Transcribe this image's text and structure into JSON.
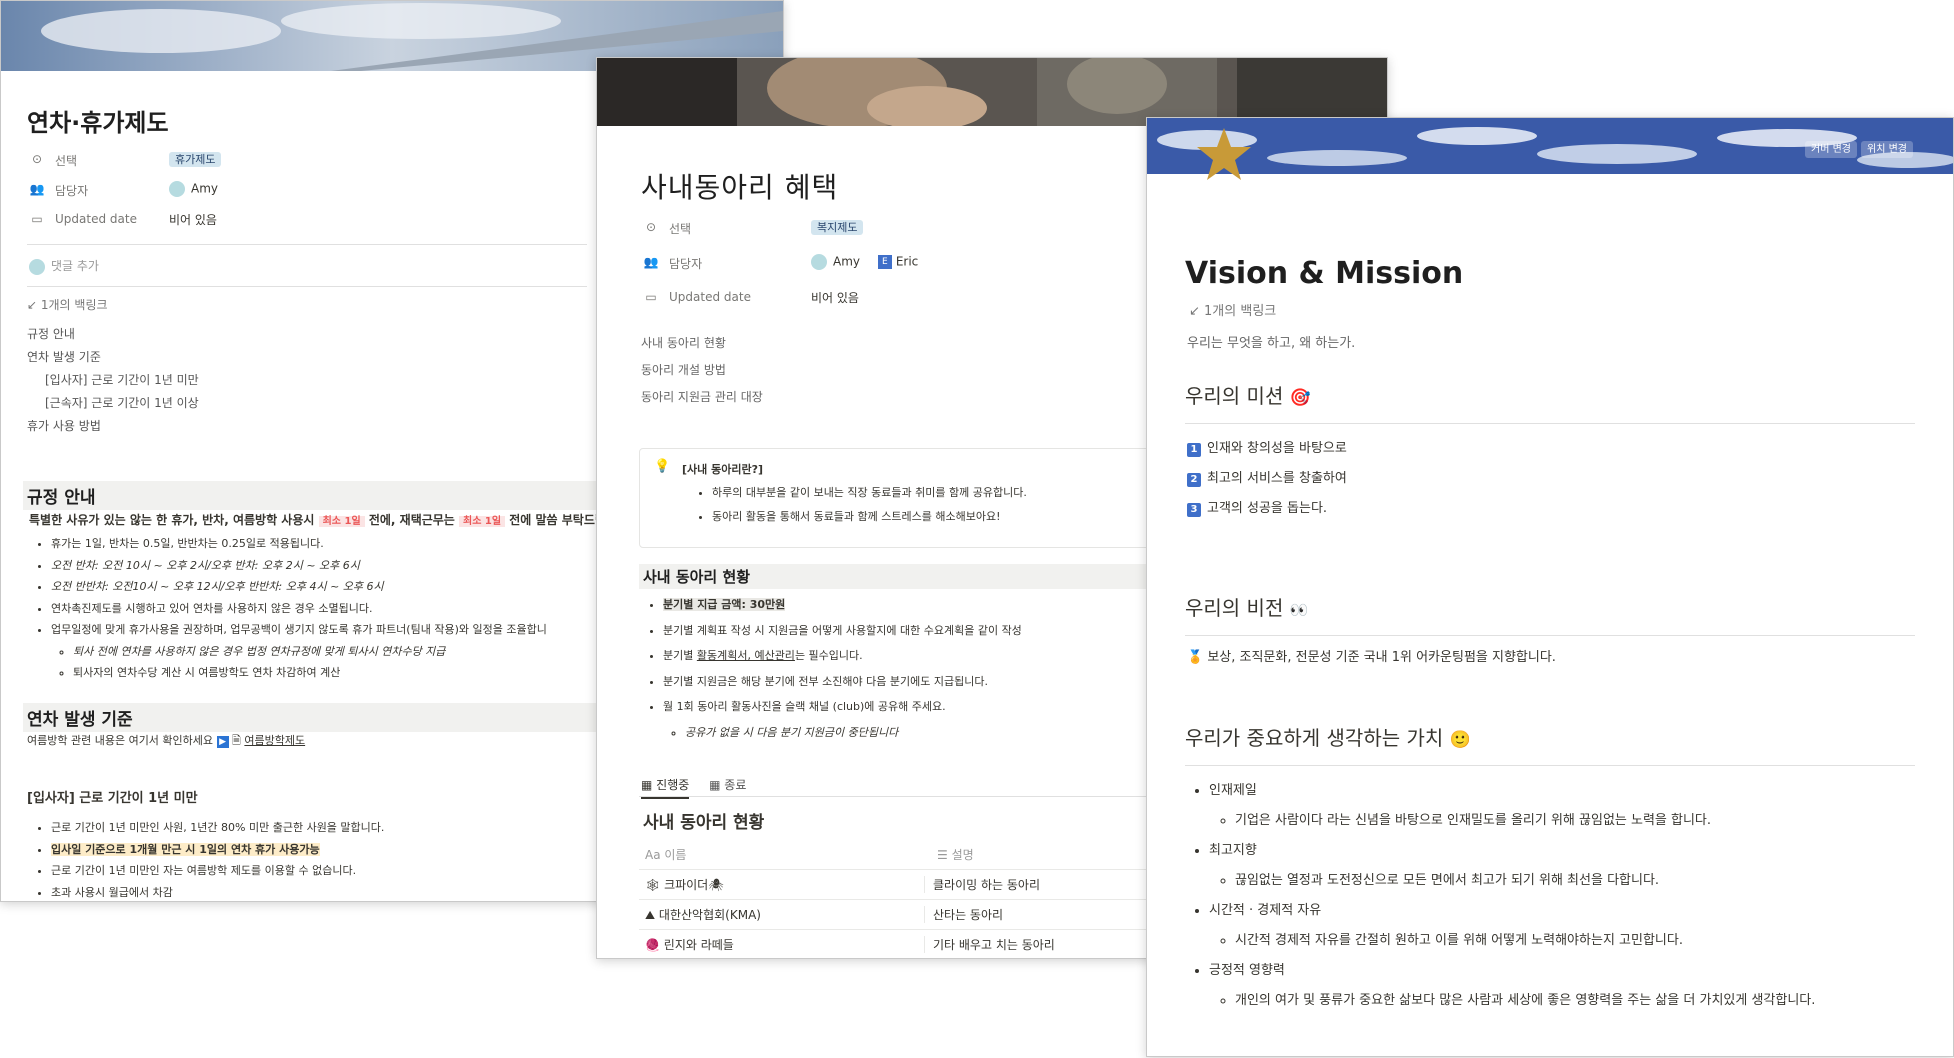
{
  "page1": {
    "title": "연차·휴가제도",
    "props": [
      {
        "icon": "⊙",
        "name": "선택",
        "value": "휴가제도"
      },
      {
        "icon": "👥",
        "name": "담당자",
        "value": "Amy"
      },
      {
        "icon": "▭",
        "name": "Updated date",
        "value": "비어 있음"
      }
    ],
    "comment": "댓글 추가",
    "backlinks": "1개의 백링크",
    "toc": [
      "규정 안내",
      "연차 발생 기준",
      "[입사자] 근로 기간이 1년 미만",
      "[근속자] 근로 기간이 1년 이상",
      "휴가 사용 방법"
    ],
    "sec1": {
      "heading": "규정 안내",
      "lead": {
        "a": "특별한 사유가 있는 않는 한 휴가, 반차, 여름방학 사용시 ",
        "tag1": "최소 1일",
        "b": " 전에, 재택근무는 ",
        "tag2": "최소 1일",
        "c": " 전에 말씀 부탁드립"
      },
      "bullets": [
        "휴가는 1일, 반차는 0.5일, 반반차는 0.25일로 적용됩니다.",
        "오전 반차: 오전 10시 ~ 오후 2시/오후 반차: 오후 2시 ~ 오후 6시",
        "오전 반반차: 오전10시 ~ 오후 12시/오후 반반차: 오후 4시 ~ 오후 6시",
        "연차촉진제도를 시행하고 있어 연차를 사용하지 않은 경우 소멸됩니다.",
        "업무일정에 맞게 휴가사용을 권장하며, 업무공백이 생기지 않도록 휴가 파트너(팀내 작용)와 일정을 조율합니"
      ],
      "subbullets": [
        "퇴사 전에 연차를 사용하지 않은 경우 법정 연차규정에 맞게 퇴사시 연차수당 지급",
        "퇴사자의 연차수당 계산 시 여름방학도 연차 차감하여 계산"
      ]
    },
    "sec2": {
      "heading": "연차 발생 기준",
      "line_prefix": "여름방학 관련 내용은 여기서 확인하세요 ",
      "link": "여름방학제도",
      "subheading": "[입사자] 근로 기간이 1년 미만",
      "bullets": [
        "근로 기간이 1년 미만인 사원, 1년간 80% 미만 출근한 사원을 말합니다.",
        "입사일 기준으로 1개월 만근 시 1일의 연차 휴가 사용가능",
        "근로 기간이 1년 미만인 자는 여름방학 제도를 이용할 수 없습니다.",
        "초과 사용시 월급에서 차감"
      ]
    }
  },
  "page2": {
    "title": "사내동아리 혜택",
    "props": [
      {
        "icon": "⊙",
        "name": "선택",
        "value": "복지제도"
      },
      {
        "icon": "👥",
        "name": "담당자",
        "value": "Amy",
        "value2": "Eric",
        "value2_initial": "E"
      },
      {
        "icon": "▭",
        "name": "Updated date",
        "value": "비어 있음"
      }
    ],
    "toc": [
      "사내 동아리 현황",
      "동아리 개설 방법",
      "동아리 지원금 관리 대장"
    ],
    "callout": {
      "icon": "💡",
      "title": "[사내 동아리란?]",
      "bullets": [
        "하루의 대부분을 같이 보내는 직장 동료들과 취미를 함께 공유합니다.",
        "동아리 활동을 통해서 동료들과 함께 스트레스를 해소해보아요!"
      ]
    },
    "sec1": {
      "heading": "사내 동아리 현황",
      "bullets": [
        "분기별 지급 금액: 30만원",
        "분기별 계획표 작성 시 지원금을 어떻게 사용할지에 대한 수요계획을 같이 작성",
        "분기별 활동계획서, 예산관리는 필수입니다.",
        "분기별 지원금은 해당 분기에 전부 소진해야 다음 분기에도 지급됩니다.",
        "월 1회 동아리 활동사진을 슬랙 채널 (club)에 공유해 주세요."
      ],
      "bullet4_highlight": "활동계획서, 예산관리",
      "bullet4_rest": "는 필수입니다.",
      "bullet4_pre": "분기별 ",
      "subbullet": "공유가 없을 시 다음 분기 지원금이 중단됩니다"
    },
    "tabs": [
      "진행중",
      "종료"
    ],
    "db": {
      "title": "사내 동아리 현황",
      "col_name": "이름",
      "col_desc": "설명",
      "rows": [
        {
          "icon": "🕸",
          "name": "크파이더🕷",
          "desc": "클라이밍 하는 동아리"
        },
        {
          "icon": "⛰",
          "name": "대한산악협회(KMA)",
          "desc": "산타는 동아리"
        },
        {
          "icon": "🧶",
          "name": "린지와 라떼들",
          "desc": "기타 배우고 치는 동아리"
        }
      ]
    }
  },
  "page3": {
    "cover_buttons": [
      "커버 변경",
      "위치 변경"
    ],
    "icon": "★",
    "title": "Vision & Mission",
    "backlinks": "1개의 백링크",
    "intro": "우리는 무엇을 하고, 왜 하는가.",
    "mission": {
      "heading": "우리의 미션",
      "emoji": "🎯",
      "items": [
        {
          "n": "1",
          "text": "인재와 창의성을 바탕으로"
        },
        {
          "n": "2",
          "text": "최고의 서비스를 창출하여"
        },
        {
          "n": "3",
          "text": "고객의 성공을 돕는다."
        }
      ]
    },
    "vision": {
      "heading": "우리의 비전",
      "emoji": "👀",
      "line_emoji": "🏅",
      "line": "보상, 조직문화, 전문성 기준 국내 1위 어카운팅펌을 지향합니다."
    },
    "values": {
      "heading": "우리가 중요하게 생각하는 가치",
      "emoji": "🙂",
      "items": [
        {
          "title": "인재제일",
          "sub": "기업은 사람이다 라는 신념을 바탕으로 인재밀도를 올리기 위해 끊임없는 노력을 합니다."
        },
        {
          "title": "최고지향",
          "sub": "끊임없는 열정과 도전정신으로 모든 면에서 최고가 되기 위해 최선을 다합니다."
        },
        {
          "title": "시간적 · 경제적 자유",
          "sub": "시간적 경제적 자유를 간절히 원하고 이를 위해 어떻게 노력해야하는지 고민합니다."
        },
        {
          "title": "긍정적 영향력",
          "sub": "개인의 여가 및 풍류가 중요한 삶보다 많은 사람과 세상에 좋은 영향력을 주는 삶을 더 가치있게 생각합니다."
        }
      ]
    }
  },
  "colors": {
    "tag_blue": "#d3e5ef",
    "tag_text": "#28456c",
    "accent_gold": "#c89a38",
    "sky_blue": "#3a5aa8"
  }
}
